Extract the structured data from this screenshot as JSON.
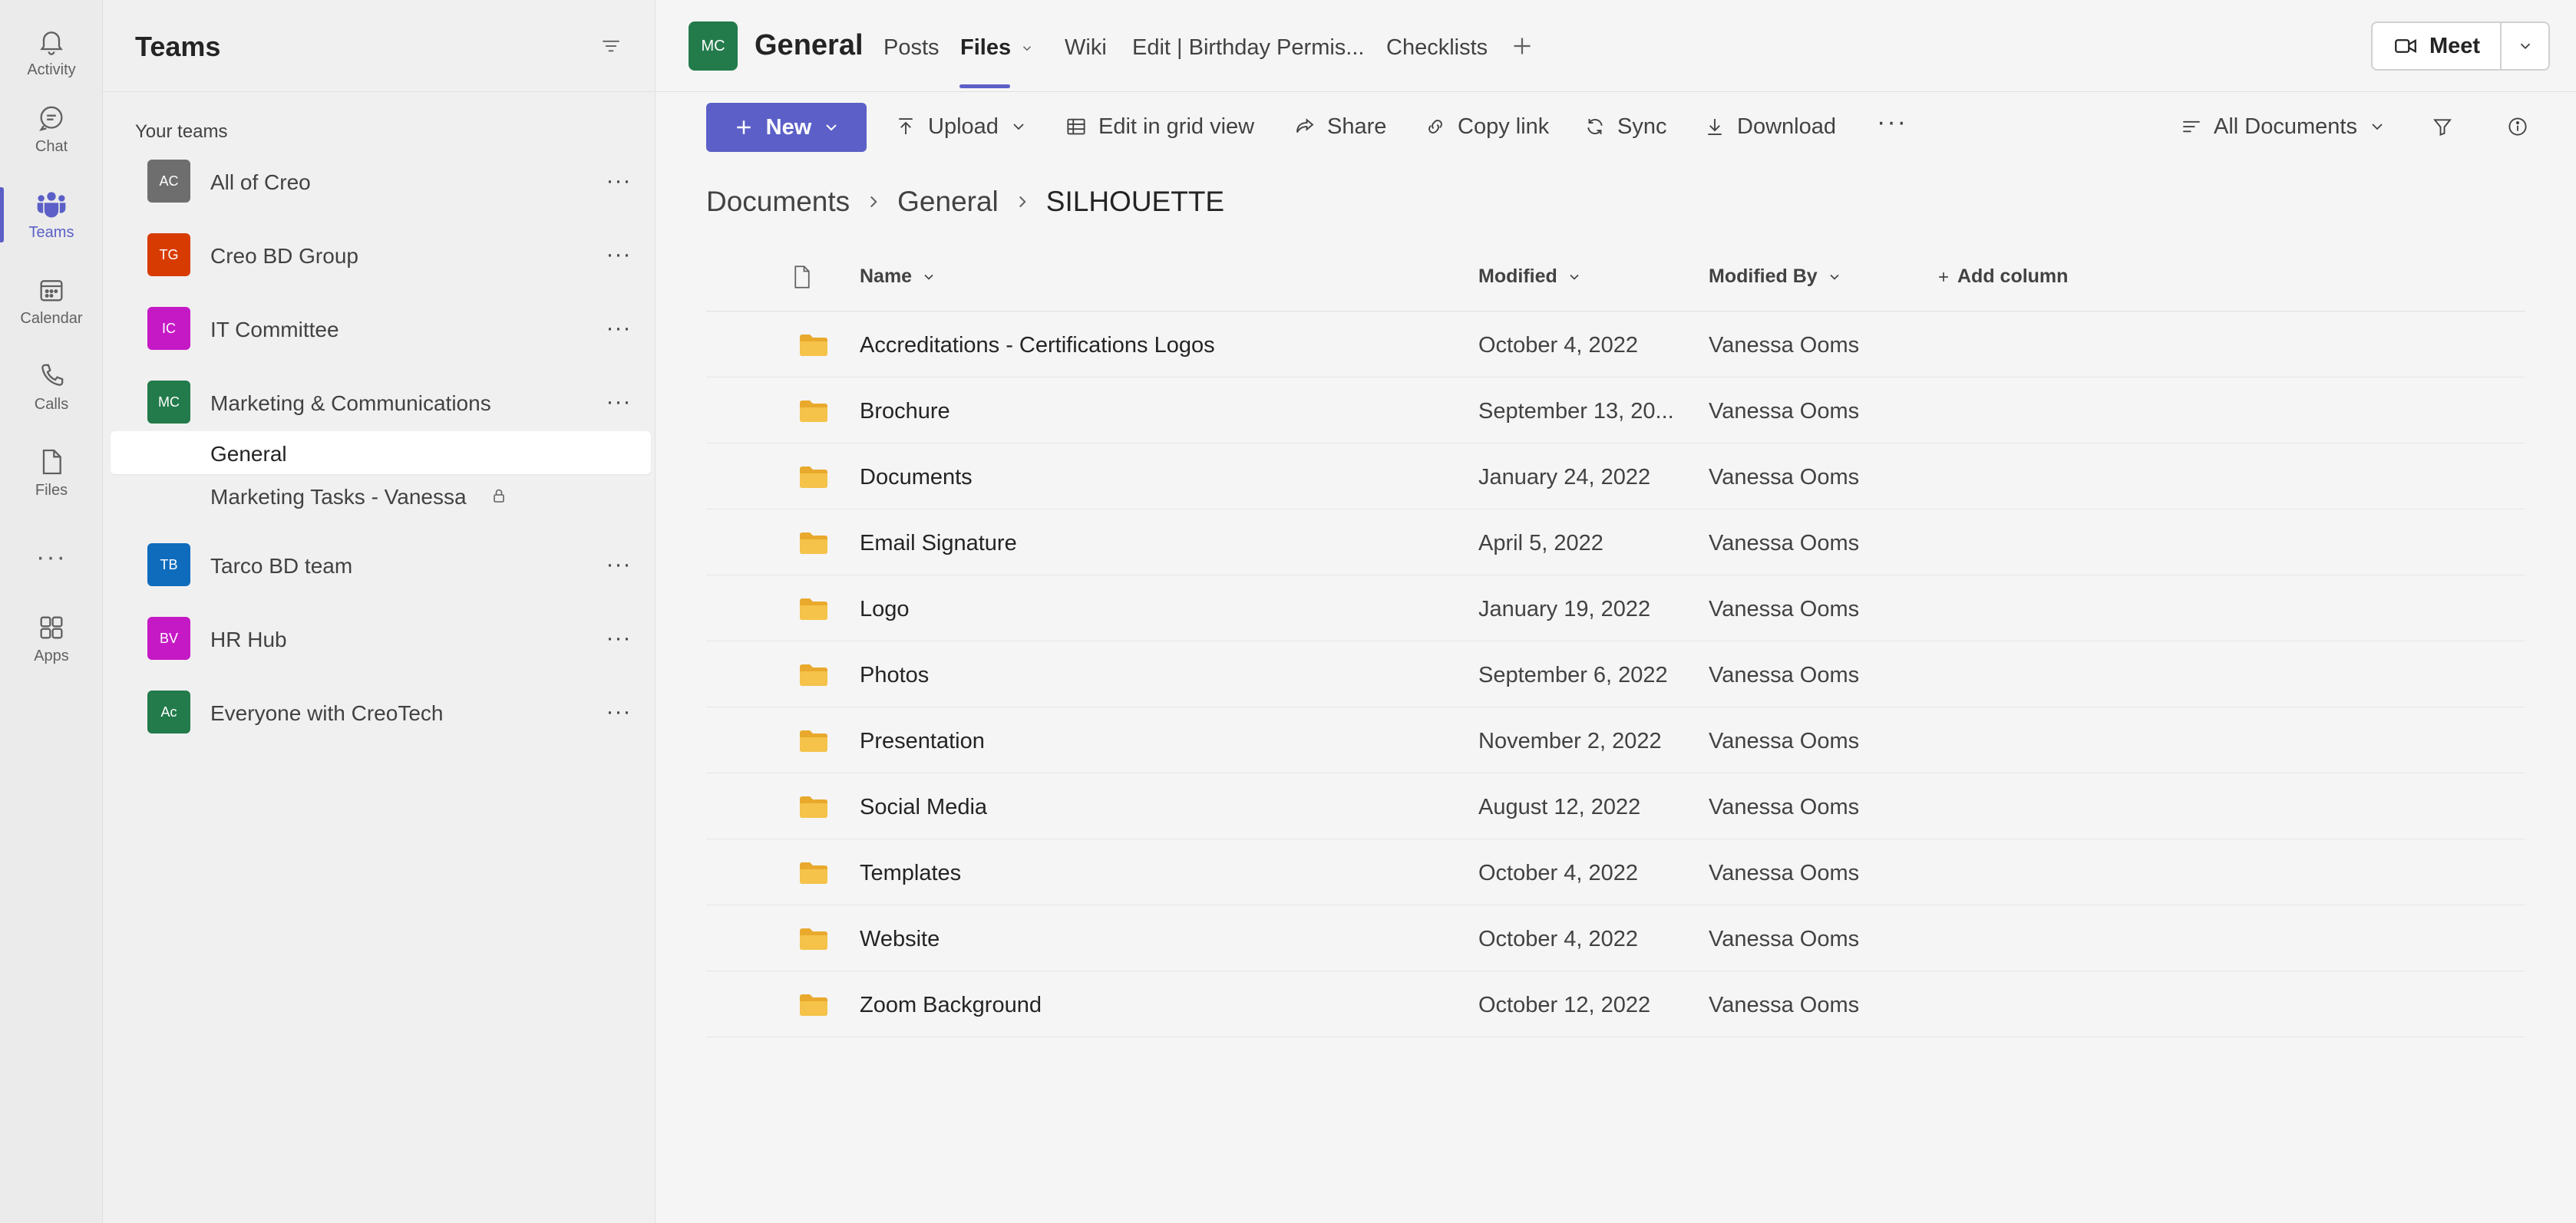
{
  "rail": {
    "items": [
      {
        "label": "Activity",
        "icon": "bell-icon"
      },
      {
        "label": "Chat",
        "icon": "chat-icon"
      },
      {
        "label": "Teams",
        "icon": "teams-icon",
        "active": true
      },
      {
        "label": "Calendar",
        "icon": "calendar-icon"
      },
      {
        "label": "Calls",
        "icon": "phone-icon"
      },
      {
        "label": "Files",
        "icon": "file-icon"
      },
      {
        "label": "Apps",
        "icon": "apps-icon"
      }
    ],
    "more": "···"
  },
  "teams_panel": {
    "title": "Teams",
    "section_label": "Your teams",
    "teams": [
      {
        "initials": "AC",
        "name": "All of Creo",
        "color": "#6e6e6e"
      },
      {
        "initials": "TG",
        "name": "Creo BD Group",
        "color": "#d83b01"
      },
      {
        "initials": "IC",
        "name": "IT Committee",
        "color": "#c619c6"
      },
      {
        "initials": "MC",
        "name": "Marketing & Communications",
        "color": "#237b4b"
      },
      {
        "initials": "TB",
        "name": "Tarco BD team",
        "color": "#0f6cbd"
      },
      {
        "initials": "BV",
        "name": "HR Hub",
        "color": "#c619c6"
      },
      {
        "initials": "Ac",
        "name": "Everyone with CreoTech",
        "color": "#237b4b"
      }
    ],
    "channels": [
      {
        "name": "General",
        "selected": true
      },
      {
        "name": "Marketing Tasks - Vanessa",
        "private": true
      }
    ],
    "more": "···"
  },
  "header": {
    "avatar": "MC",
    "title": "General",
    "tabs": [
      "Posts",
      "Files",
      "Wiki",
      "Edit | Birthday Permis...",
      "Checklists"
    ],
    "active_tab": "Files",
    "meet_label": "Meet"
  },
  "commands": {
    "new": "New",
    "upload": "Upload",
    "grid": "Edit in grid view",
    "share": "Share",
    "copy_link": "Copy link",
    "sync": "Sync",
    "download": "Download",
    "more": "···",
    "view": "All Documents"
  },
  "breadcrumb": [
    "Documents",
    "General",
    "SILHOUETTE"
  ],
  "table": {
    "columns": {
      "name": "Name",
      "modified": "Modified",
      "modified_by": "Modified By",
      "add": "Add column"
    },
    "rows": [
      {
        "name": "Accreditations - Certifications Logos",
        "modified": "October 4, 2022",
        "by": "Vanessa Ooms"
      },
      {
        "name": "Brochure",
        "modified": "September 13, 20...",
        "by": "Vanessa Ooms"
      },
      {
        "name": "Documents",
        "modified": "January 24, 2022",
        "by": "Vanessa Ooms"
      },
      {
        "name": "Email Signature",
        "modified": "April 5, 2022",
        "by": "Vanessa Ooms"
      },
      {
        "name": "Logo",
        "modified": "January 19, 2022",
        "by": "Vanessa Ooms"
      },
      {
        "name": "Photos",
        "modified": "September 6, 2022",
        "by": "Vanessa Ooms"
      },
      {
        "name": "Presentation",
        "modified": "November 2, 2022",
        "by": "Vanessa Ooms"
      },
      {
        "name": "Social Media",
        "modified": "August 12, 2022",
        "by": "Vanessa Ooms"
      },
      {
        "name": "Templates",
        "modified": "October 4, 2022",
        "by": "Vanessa Ooms"
      },
      {
        "name": "Website",
        "modified": "October 4, 2022",
        "by": "Vanessa Ooms"
      },
      {
        "name": "Zoom Background",
        "modified": "October 12, 2022",
        "by": "Vanessa Ooms"
      }
    ]
  },
  "colors": {
    "accent": "#5b5fc7",
    "folder": "#f5c34a"
  }
}
